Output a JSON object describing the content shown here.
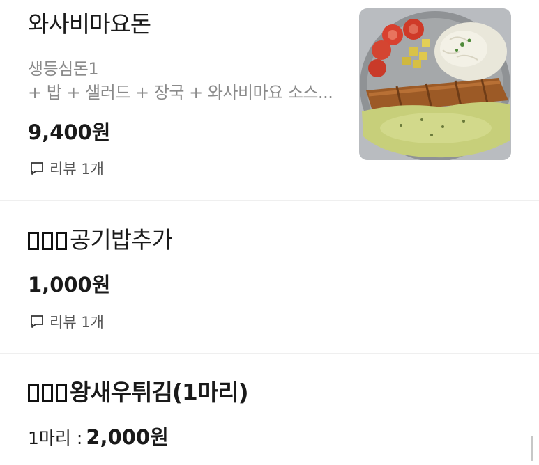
{
  "items": [
    {
      "name": "와사비마요돈",
      "desc_line1": "생등심돈1",
      "desc_line2": "+ 밥 + 샐러드 + 장국 + 와사비마요 소스...",
      "price": "9,400원",
      "review": "리뷰 1개",
      "image_icon": "dish-photo"
    },
    {
      "name": "공기밥추가",
      "price": "1,000원",
      "review": "리뷰 1개"
    },
    {
      "name": "왕새우튀김(1마리)",
      "qty_label": "1마리 :",
      "price": "2,000원"
    }
  ],
  "icons": {
    "review": "speech-bubble-icon"
  },
  "colors": {
    "text": "#1a1a1a",
    "muted": "#8a8a8a",
    "divider": "#efefef"
  }
}
